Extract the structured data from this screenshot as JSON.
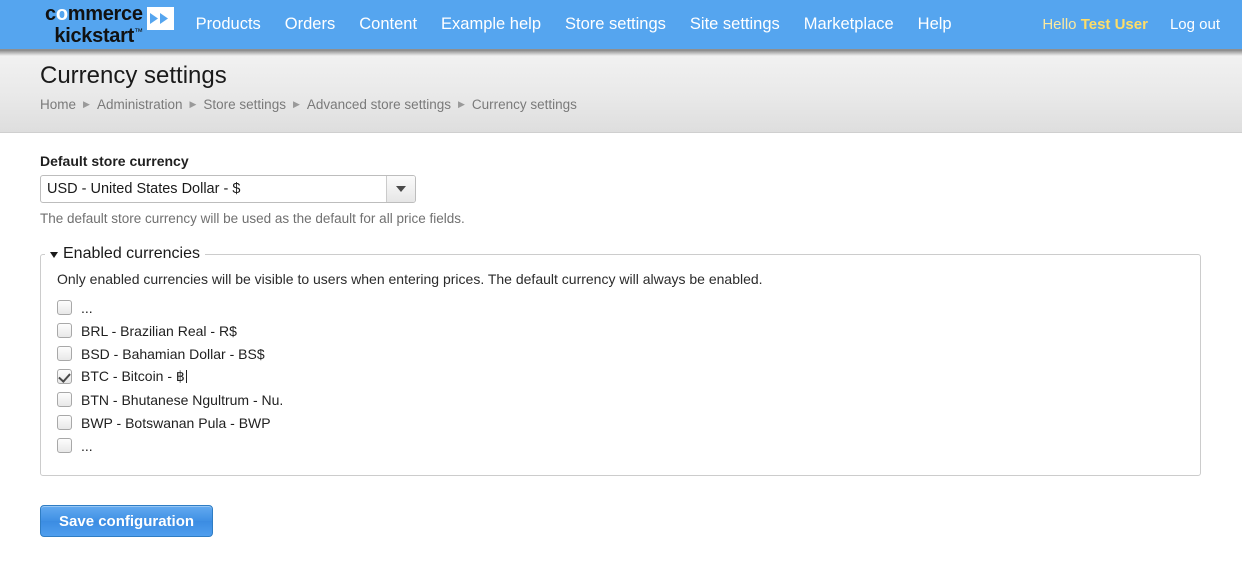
{
  "brand": {
    "logo_line1": "commerce",
    "logo_line2": "kickstart",
    "logo_tm": "™",
    "badge_icon": "double-chevron-right-icon"
  },
  "nav": {
    "links": [
      {
        "label": "Products"
      },
      {
        "label": "Orders"
      },
      {
        "label": "Content"
      },
      {
        "label": "Example help"
      },
      {
        "label": "Store settings"
      },
      {
        "label": "Site settings"
      },
      {
        "label": "Marketplace"
      },
      {
        "label": "Help"
      }
    ],
    "greeting_prefix": "Hello ",
    "user_name": "Test User",
    "logout_label": "Log out"
  },
  "header": {
    "title": "Currency settings",
    "breadcrumb": [
      {
        "label": "Home"
      },
      {
        "label": "Administration"
      },
      {
        "label": "Store settings"
      },
      {
        "label": "Advanced store settings"
      },
      {
        "label": "Currency settings"
      }
    ],
    "separator": "▶"
  },
  "default_currency": {
    "label": "Default store currency",
    "selected": "USD - United States Dollar - $",
    "description": "The default store currency will be used as the default for all price fields."
  },
  "enabled_currencies": {
    "legend": "Enabled currencies",
    "description": "Only enabled currencies will be visible to users when entering prices. The default currency will always be enabled.",
    "items": [
      {
        "label": "...",
        "checked": false
      },
      {
        "label": "BRL - Brazilian Real - R$",
        "checked": false
      },
      {
        "label": "BSD - Bahamian Dollar - BS$",
        "checked": false
      },
      {
        "label": "BTC - Bitcoin - ฿",
        "checked": true
      },
      {
        "label": "BTN - Bhutanese Ngultrum - Nu.",
        "checked": false
      },
      {
        "label": "BWP - Botswanan Pula - BWP",
        "checked": false
      },
      {
        "label": "...",
        "checked": false
      }
    ]
  },
  "actions": {
    "save_label": "Save configuration"
  },
  "colors": {
    "navbar": "#55a5ef",
    "accent_button": "#3f90e4",
    "user_name": "#ffdd66",
    "greeting": "#fbe9a0"
  }
}
